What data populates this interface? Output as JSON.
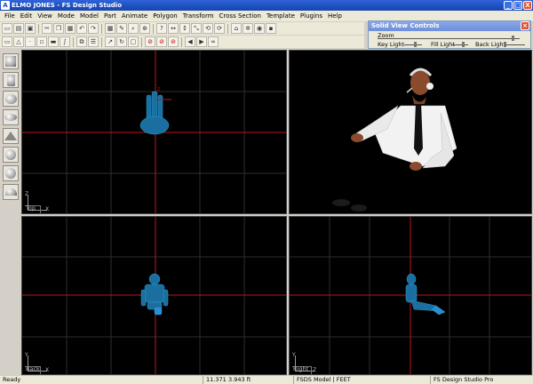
{
  "app": {
    "title": "ELMO JONES - FS Design Studio",
    "icon_letter": "A"
  },
  "window_buttons": [
    "_",
    "□",
    "X"
  ],
  "menu": [
    "File",
    "Edit",
    "View",
    "Mode",
    "Model",
    "Part",
    "Animate",
    "Polygon",
    "Transform",
    "Cross Section",
    "Template",
    "Plugins",
    "Help"
  ],
  "toolbar1_icons": [
    "new-icon",
    "open-icon",
    "save-icon",
    "cut-icon",
    "copy-icon",
    "paste-icon",
    "undo-icon",
    "redo-icon",
    "grid-icon",
    "paint-icon",
    "zoom-icon",
    "zoom-in-icon",
    "help-icon",
    "arrow-x-icon",
    "arrow-y-icon",
    "arrow-z-icon",
    "rotate-x-icon",
    "rotate-y-icon",
    "home-icon",
    "settings-icon",
    "view-icon",
    "camera-icon"
  ],
  "toolbar2_icons": [
    "select-icon",
    "triangle-icon",
    "point-icon",
    "box-icon",
    "ruler-icon",
    "spline-icon",
    "mirror-icon",
    "align-icon",
    "rotate-icon",
    "refresh-icon",
    "lock-icon",
    "no-tex-icon",
    "no-light-icon",
    "no-shade-icon",
    "prev-icon",
    "next-icon",
    "binoculars-icon"
  ],
  "solid_view": {
    "title": "Solid View Controls",
    "zoom_label": "Zoom",
    "key_light_label": "Key Light",
    "fill_light_label": "Fill Light",
    "back_light_label": "Back Light",
    "zoom_value": 0.95,
    "key_light_value": 0.6,
    "fill_light_value": 0.65,
    "back_light_value": 0.05
  },
  "palette": [
    "cube-shape-icon",
    "cylinder-shape-icon",
    "sphere-shape-icon",
    "ellipsoid-shape-icon",
    "cone-shape-icon",
    "geodesic-shape-icon",
    "ball-shape-icon",
    "dome-shape-icon"
  ],
  "viewports": {
    "top": {
      "label": "Top",
      "axis_v": "Z",
      "axis_h": "X"
    },
    "perspective": {
      "label": ""
    },
    "back": {
      "label": "Back",
      "axis_v": "Y",
      "axis_h": "X"
    },
    "right": {
      "label": "Right",
      "axis_v": "Y",
      "axis_h": "Z"
    }
  },
  "status": {
    "left": "Ready",
    "coords": "11.371",
    "coords2": "3.943 ft",
    "model": "FSDS Model | FEET",
    "product": "FS Design Studio Pro"
  },
  "colors": {
    "grid": "#2e2e2e",
    "axis": "#c0161a",
    "wireframe": "#1a6fa0"
  }
}
